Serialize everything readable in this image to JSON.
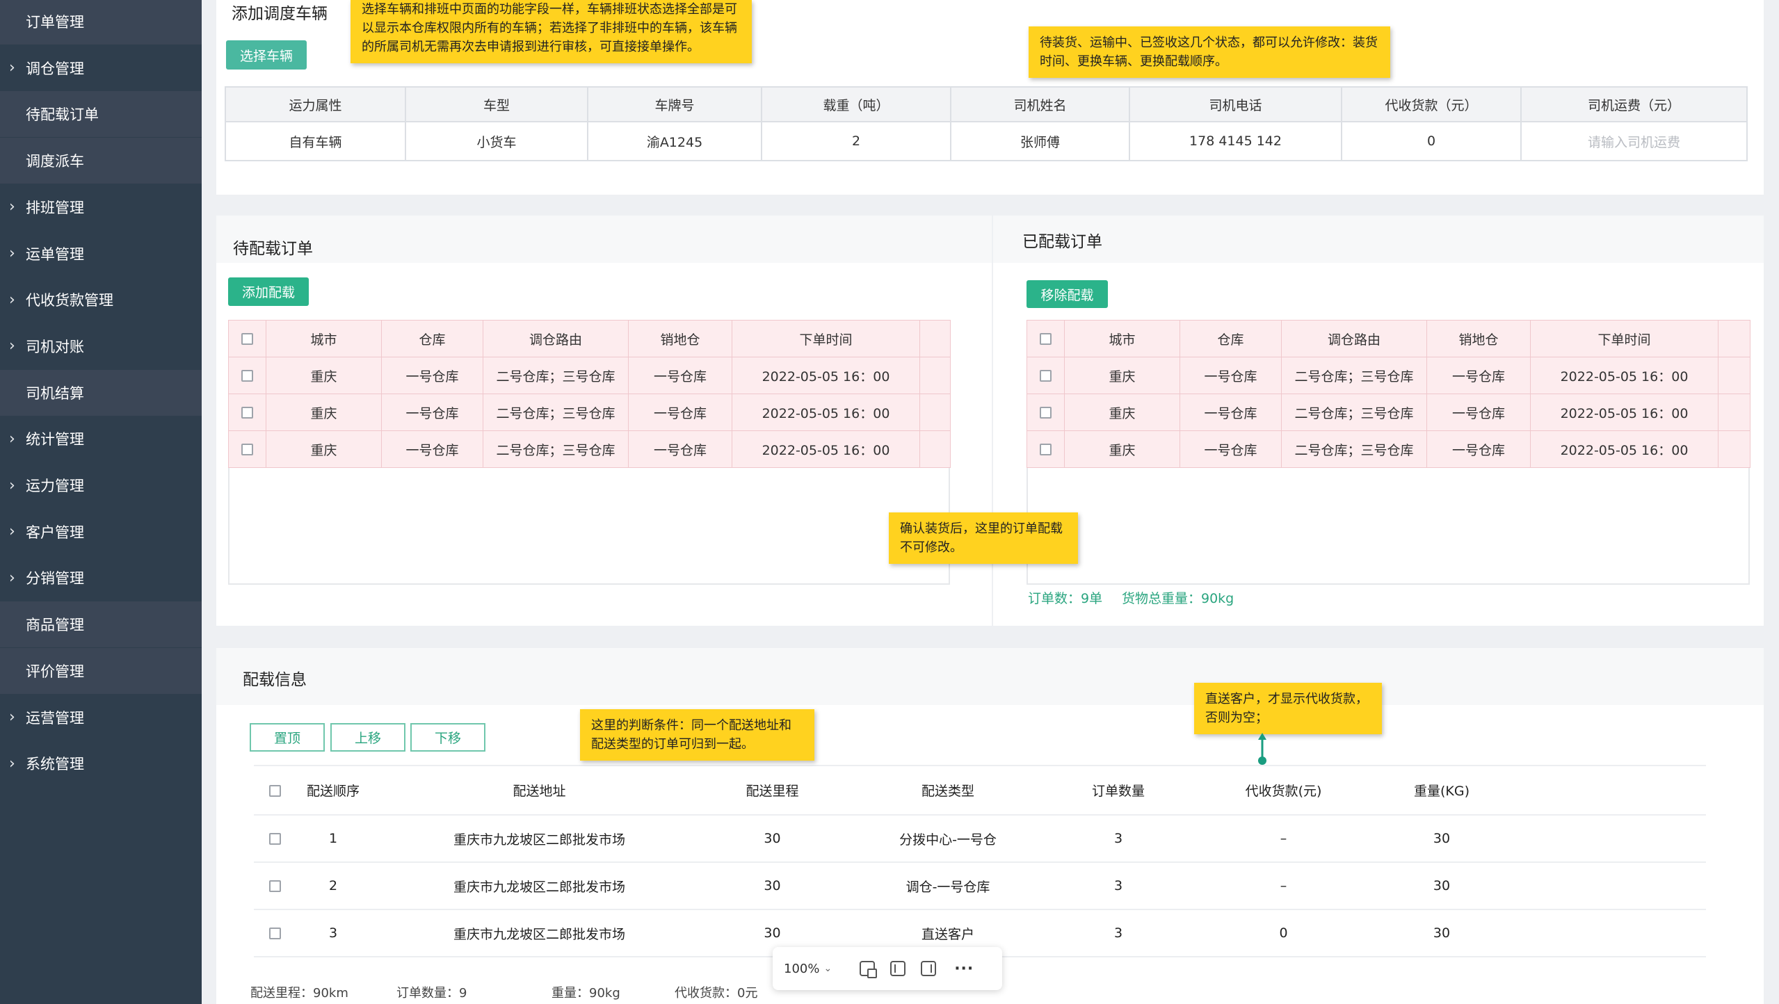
{
  "sidebar": {
    "items": [
      {
        "label": "订单管理",
        "chevron": false,
        "sub": true
      },
      {
        "label": "调仓管理",
        "chevron": true,
        "sub": false
      },
      {
        "label": "待配载订单",
        "chevron": false,
        "sub": true
      },
      {
        "label": "调度派车",
        "chevron": false,
        "sub": true
      },
      {
        "label": "排班管理",
        "chevron": true,
        "sub": false
      },
      {
        "label": "运单管理",
        "chevron": true,
        "sub": false
      },
      {
        "label": "代收货款管理",
        "chevron": true,
        "sub": false
      },
      {
        "label": "司机对账",
        "chevron": true,
        "sub": false
      },
      {
        "label": "司机结算",
        "chevron": false,
        "sub": true
      },
      {
        "label": "统计管理",
        "chevron": true,
        "sub": false
      },
      {
        "label": "运力管理",
        "chevron": true,
        "sub": false
      },
      {
        "label": "客户管理",
        "chevron": true,
        "sub": false
      },
      {
        "label": "分销管理",
        "chevron": true,
        "sub": false
      },
      {
        "label": "商品管理",
        "chevron": false,
        "sub": true
      },
      {
        "label": "评价管理",
        "chevron": false,
        "sub": true
      },
      {
        "label": "运营管理",
        "chevron": true,
        "sub": false
      },
      {
        "label": "系统管理",
        "chevron": true,
        "sub": false
      }
    ]
  },
  "vehicle": {
    "title": "添加调度车辆",
    "select_button": "选择车辆",
    "headers": [
      "运力属性",
      "车型",
      "车牌号",
      "载重（吨）",
      "司机姓名",
      "司机电话",
      "代收货款（元）",
      "司机运费（元）"
    ],
    "row": [
      "自有车辆",
      "小货车",
      "渝A1245",
      "2",
      "张师傅",
      "178 4145 142",
      "0"
    ],
    "fee_placeholder": "请输入司机运费"
  },
  "pending": {
    "title": "待配载订单",
    "add_button": "添加配载",
    "headers": [
      "城市",
      "仓库",
      "调仓路由",
      "销地仓",
      "下单时间"
    ],
    "rows": [
      [
        "重庆",
        "一号仓库",
        "二号仓库；三号仓库",
        "一号仓库",
        "2022-05-05 16：00"
      ],
      [
        "重庆",
        "一号仓库",
        "二号仓库；三号仓库",
        "一号仓库",
        "2022-05-05 16：00"
      ],
      [
        "重庆",
        "一号仓库",
        "二号仓库；三号仓库",
        "一号仓库",
        "2022-05-05 16：00"
      ]
    ]
  },
  "loaded": {
    "title": "已配载订单",
    "remove_button": "移除配载",
    "headers": [
      "城市",
      "仓库",
      "调仓路由",
      "销地仓",
      "下单时间"
    ],
    "rows": [
      [
        "重庆",
        "一号仓库",
        "二号仓库；三号仓库",
        "一号仓库",
        "2022-05-05 16：00"
      ],
      [
        "重庆",
        "一号仓库",
        "二号仓库；三号仓库",
        "一号仓库",
        "2022-05-05 16：00"
      ],
      [
        "重庆",
        "一号仓库",
        "二号仓库；三号仓库",
        "一号仓库",
        "2022-05-05 16：00"
      ]
    ],
    "summary_count": "订单数：9单",
    "summary_weight": "货物总重量：90kg"
  },
  "delivery": {
    "title": "配载信息",
    "top_button": "置顶",
    "up_button": "上移",
    "down_button": "下移",
    "headers": [
      "配送顺序",
      "配送地址",
      "配送里程",
      "配送类型",
      "订单数量",
      "代收货款(元)",
      "重量(KG)"
    ],
    "rows": [
      [
        "1",
        "重庆市九龙坡区二郎批发市场",
        "30",
        "分拨中心-一号仓",
        "3",
        "–",
        "30"
      ],
      [
        "2",
        "重庆市九龙坡区二郎批发市场",
        "30",
        "调仓-一号仓库",
        "3",
        "–",
        "30"
      ],
      [
        "3",
        "重庆市九龙坡区二郎批发市场",
        "30",
        "直送客户",
        "3",
        "0",
        "30"
      ]
    ],
    "footer": {
      "distance": "配送里程：90km",
      "orders": "订单数量：9",
      "weight": "重量：90kg",
      "cod": "代收货款：0元"
    }
  },
  "notes": {
    "n1": "选择车辆和排班中页面的功能字段一样，车辆排班状态选择全部是可以显示本仓库权限内所有的车辆；若选择了非排班中的车辆，该车辆的所属司机无需再次去申请报到进行审核，可直接接单操作。",
    "n2": "待装货、运输中、已签收这几个状态，都可以允许修改：装货时间、更换车辆、更换配载顺序。",
    "n3": "确认装货后，这里的订单配载不可修改。",
    "n4": "这里的判断条件：同一个配送地址和配送类型的订单可归到一起。",
    "n5": "直送客户，才显示代收货款，否则为空；"
  },
  "zoom": {
    "level": "100%"
  },
  "colors": {
    "sidebar": "#2f3e4d",
    "accent": "#2bb38a",
    "note": "#ffd21f",
    "order_row": "#fdecee"
  }
}
